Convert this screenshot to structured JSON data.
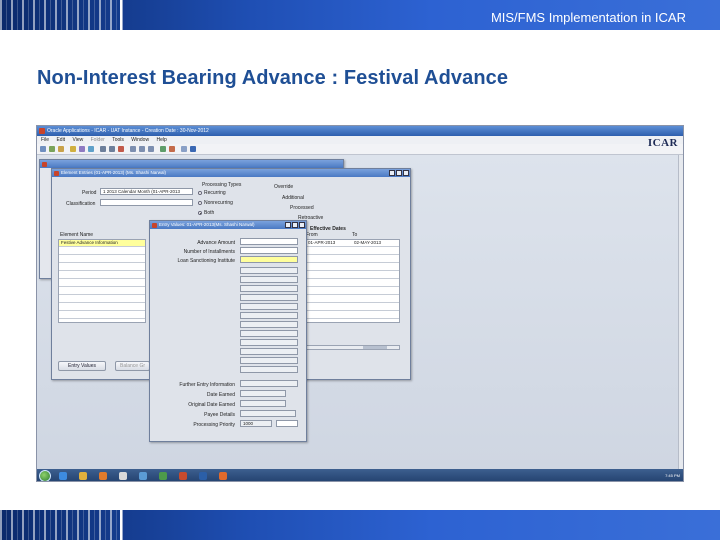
{
  "header": {
    "title": "MIS/FMS Implementation in ICAR"
  },
  "slide": {
    "title": "Non-Interest Bearing Advance : Festival Advance"
  },
  "oracle_app": {
    "window_title": "Oracle Applications - ICAR - UAT Instance - Creation Date : 30-Nov-2012",
    "brand": "ICAR",
    "menu": [
      "File",
      "Edit",
      "View",
      "Folder",
      "Tools",
      "Window",
      "Help"
    ],
    "element_entries": {
      "title": "Element Entries (01-APR-2013) (Ms. Shashi Narwal)",
      "period_label": "Period",
      "period_value": "1 2013 Calendar Month (01-APR-2013",
      "classification_label": "Classification",
      "processing_types_label": "Processing Types",
      "processing_types": [
        "Recurring",
        "Nonrecurring",
        "Both"
      ],
      "selected_processing_type": "Both",
      "override_label": "Override",
      "override_items": [
        "Additional",
        "Processed",
        "Retroactive"
      ],
      "effective_dates_label": "Effective Dates",
      "from_label": "From",
      "to_label": "To",
      "from_value": "01-APR-2013",
      "to_value": "02-MAY-2013",
      "element_name_header": "Element Name",
      "element_row": "Festive Advance Information",
      "entry_values_button": "Entry Values",
      "balance_button": "Balance Gr"
    },
    "entry_values": {
      "title": "Entry Values: 01-APR-2013(Ms. Shashi Narwal)",
      "labels": [
        "Advance Amount",
        "Number of Installments",
        "Loan Sanctioning Institute"
      ],
      "further_label": "Further Entry Information",
      "date_earned_label": "Date Earned",
      "original_date_label": "Original Date Earned",
      "payee_details_label": "Payee Details",
      "processing_priority_label": "Processing Priority",
      "processing_priority_value": "1000"
    },
    "taskbar": {
      "clock": "7:45 PM"
    }
  }
}
